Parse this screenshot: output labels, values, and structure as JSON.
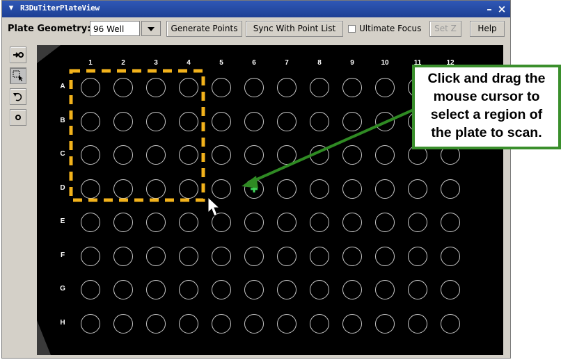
{
  "window": {
    "title": "R3DuTiterPlateView",
    "sysmenu_glyph": "▾",
    "minimize_glyph": "–",
    "close_glyph": "×"
  },
  "toolbar": {
    "plate_geometry_label": "Plate Geometry:",
    "plate_geometry_value": "96 Well",
    "generate_points_label": "Generate Points",
    "sync_label": "Sync With Point List",
    "ultimate_focus_label": "Ultimate Focus",
    "ultimate_focus_checked": false,
    "set_z_label": "Set Z",
    "help_label": "Help"
  },
  "tools": [
    {
      "name": "add-point-tool",
      "icon": "arrow-circle-icon",
      "active": false
    },
    {
      "name": "select-region-tool",
      "icon": "marquee-select-icon",
      "active": true
    },
    {
      "name": "undo-tool",
      "icon": "undo-icon",
      "active": false
    },
    {
      "name": "point-tool",
      "icon": "circle-icon",
      "active": false
    }
  ],
  "plate": {
    "columns": [
      "1",
      "2",
      "3",
      "4",
      "5",
      "6",
      "7",
      "8",
      "9",
      "10",
      "11",
      "12"
    ],
    "rows": [
      "A",
      "B",
      "C",
      "D",
      "E",
      "F",
      "G",
      "H"
    ],
    "selected_region": {
      "rows": [
        "A",
        "B",
        "C",
        "D"
      ],
      "columns": [
        "1",
        "2",
        "3",
        "4"
      ]
    },
    "marked_well": {
      "row": "D",
      "column": "6"
    },
    "colors": {
      "background": "#000000",
      "well_outline": "#c8c8c8",
      "selection": "#f2b21b",
      "marker": "#3fd65a"
    }
  },
  "callout": {
    "lines": [
      "Click and drag the",
      "mouse cursor to",
      "select a region of",
      "the plate to scan."
    ],
    "border_color": "#3a8f2c",
    "arrow_color": "#2f8a23"
  }
}
